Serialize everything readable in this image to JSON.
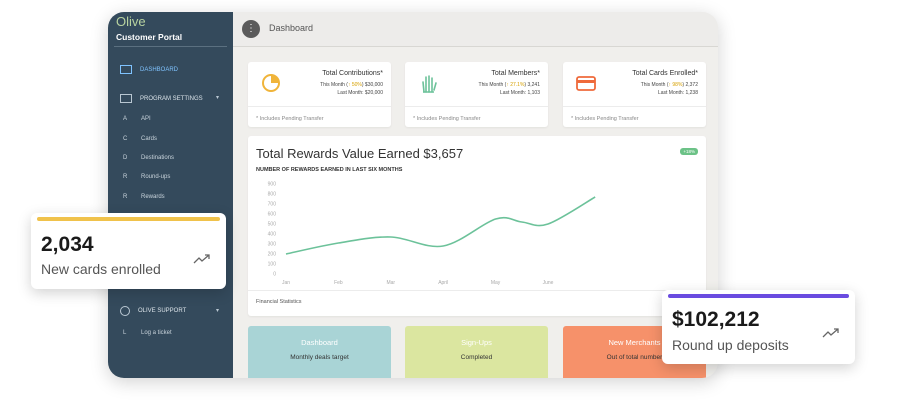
{
  "app": {
    "brand": "Olive",
    "subtitle": "Customer Portal",
    "page_title": "Dashboard"
  },
  "sidebar": {
    "dashboard_label": "DASHBOARD",
    "program_settings_label": "PROGRAM SETTINGS",
    "sub_items": [
      {
        "letter": "A",
        "label": "API"
      },
      {
        "letter": "C",
        "label": "Cards"
      },
      {
        "letter": "D",
        "label": "Destinations"
      },
      {
        "letter": "R",
        "label": "Round-ups"
      },
      {
        "letter": "R",
        "label": "Rewards"
      }
    ],
    "support_label": "OLIVE SUPPORT",
    "support_items": [
      {
        "letter": "L",
        "label": "Log a ticket"
      }
    ]
  },
  "stats": [
    {
      "icon": "pie-chart-icon",
      "title": "Total Contributions*",
      "this_month_prefix": "This Month (",
      "this_month_pct": "↑ 50%",
      "this_month_suffix": ") $30,000",
      "last_month": "Last Month: $20,000",
      "note": "* Includes Pending Transfer"
    },
    {
      "icon": "hand-icon",
      "title": "Total Members*",
      "this_month_prefix": "This Month (",
      "this_month_pct": "↑ 27.1%",
      "this_month_suffix": ") 3,241",
      "last_month": "Last Month: 1,103",
      "note": "* Includes Pending Transfer"
    },
    {
      "icon": "credit-card-icon",
      "title": "Total Cards Enrolled*",
      "this_month_prefix": "This Month (",
      "this_month_pct": "↑ 98%",
      "this_month_suffix": ") 2,372",
      "last_month": "Last Month: 1,238",
      "note": "* Includes Pending Transfer"
    }
  ],
  "rewards": {
    "title": "Total Rewards Value Earned $3,657",
    "subtitle": "NUMBER OF REWARDS EARNED IN LAST SIX MONTHS",
    "badge": "+18%",
    "footer": "Financial Statistics"
  },
  "chart_data": {
    "type": "line",
    "title": "Total Rewards Value Earned $3,657",
    "subtitle": "NUMBER OF REWARDS EARNED IN LAST SIX MONTHS",
    "categories": [
      "Jan",
      "Feb",
      "Mar",
      "April",
      "May",
      "June"
    ],
    "y_ticks": [
      0,
      100,
      200,
      300,
      400,
      500,
      600,
      700,
      800,
      900
    ],
    "ylim": [
      0,
      900
    ],
    "x": [
      0,
      1,
      2,
      3,
      4,
      4.5,
      5,
      5.9
    ],
    "y": [
      200,
      310,
      370,
      280,
      550,
      520,
      500,
      770
    ],
    "color": "#6cc29a",
    "grid": false,
    "legend": "none"
  },
  "tiles": [
    {
      "title": "Dashboard",
      "sub": "Monthly deals target",
      "color": "#a9d4d6"
    },
    {
      "title": "Sign-Ups",
      "sub": "Completed",
      "color": "#dbe6a0"
    },
    {
      "title": "New Merchants",
      "sub": "Out of total number",
      "color": "#f6916a"
    }
  ],
  "float_cards": [
    {
      "value": "2,034",
      "label": "New cards enrolled",
      "bar_color": "#f0c24b"
    },
    {
      "value": "$102,212",
      "label": "Round up deposits",
      "bar_color": "#6a4ce0"
    }
  ]
}
